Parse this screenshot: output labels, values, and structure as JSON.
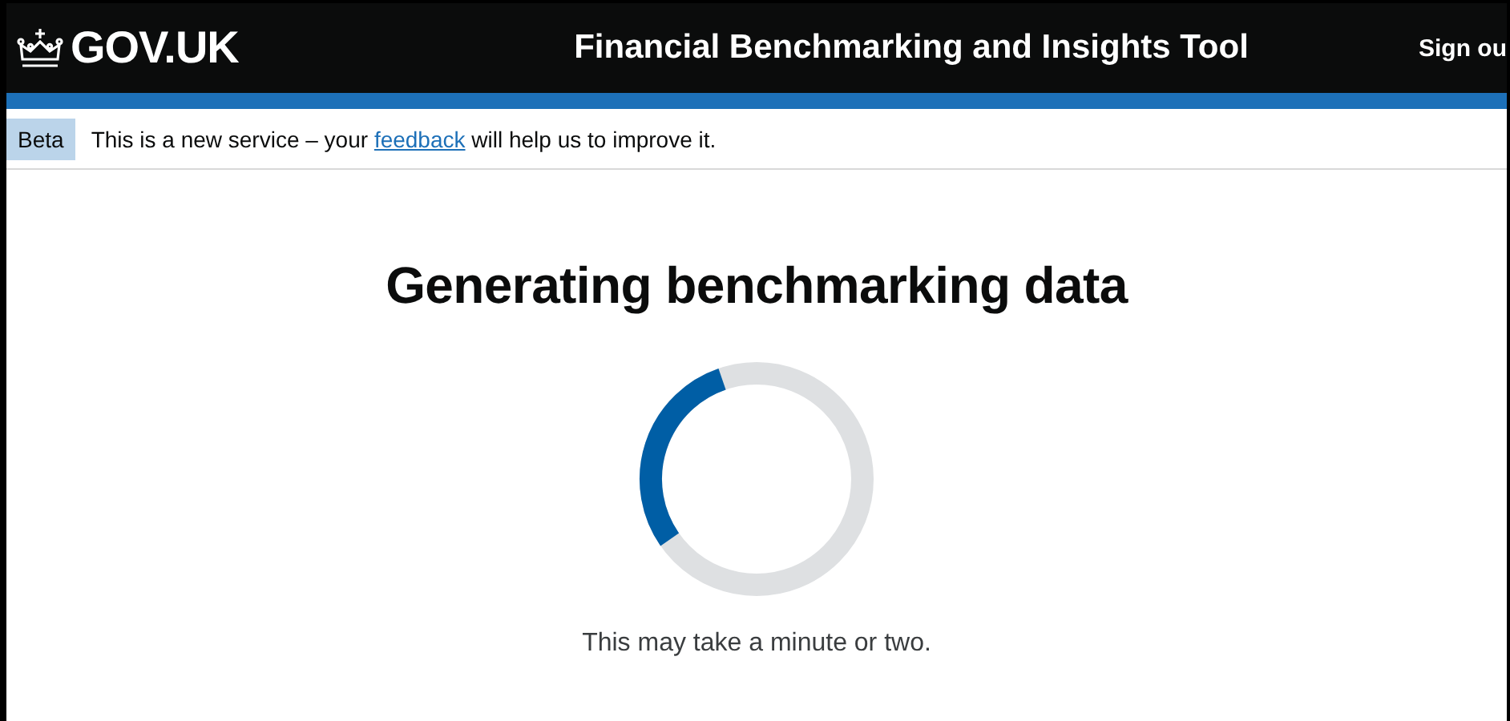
{
  "header": {
    "logo": "GOV.UK",
    "service_name": "Financial Benchmarking and Insights Tool",
    "sign_out": "Sign ou"
  },
  "phase_banner": {
    "tag": "Beta",
    "text_before": "This is a new service – your ",
    "link": "feedback",
    "text_after": " will help us to improve it."
  },
  "main": {
    "heading": "Generating benchmarking data",
    "message": "This may take a minute or two."
  }
}
